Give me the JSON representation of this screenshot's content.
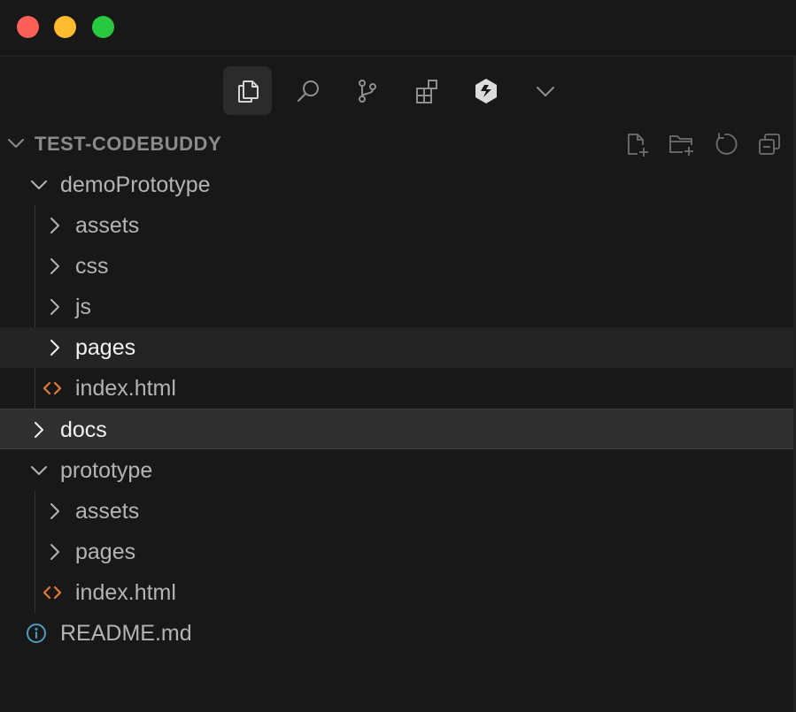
{
  "window": {
    "traffic_lights": [
      {
        "name": "close",
        "color": "#fe5f57"
      },
      {
        "name": "minimize",
        "color": "#febc2e"
      },
      {
        "name": "zoom",
        "color": "#28c840"
      }
    ]
  },
  "activity_bar": {
    "items": [
      {
        "icon": "files-icon",
        "active": true
      },
      {
        "icon": "search-icon",
        "active": false
      },
      {
        "icon": "source-control-icon",
        "active": false
      },
      {
        "icon": "extensions-icon",
        "active": false
      },
      {
        "icon": "codebuddy-icon",
        "active": false
      },
      {
        "icon": "chevron-down-icon",
        "active": false
      }
    ]
  },
  "explorer": {
    "section_title": "TEST-CODEBUDDY",
    "actions": [
      "new-file-icon",
      "new-folder-icon",
      "refresh-icon",
      "collapse-all-icon"
    ],
    "items": [
      {
        "label": "demoPrototype",
        "type": "folder",
        "expanded": true
      },
      {
        "label": "assets",
        "type": "folder",
        "expanded": false
      },
      {
        "label": "css",
        "type": "folder",
        "expanded": false
      },
      {
        "label": "js",
        "type": "folder",
        "expanded": false
      },
      {
        "label": "pages",
        "type": "folder",
        "expanded": false,
        "state": "hover"
      },
      {
        "label": "index.html",
        "type": "html-file"
      },
      {
        "label": "docs",
        "type": "folder",
        "expanded": false,
        "state": "selected"
      },
      {
        "label": "prototype",
        "type": "folder",
        "expanded": true
      },
      {
        "label": "assets",
        "type": "folder",
        "expanded": false
      },
      {
        "label": "pages",
        "type": "folder",
        "expanded": false
      },
      {
        "label": "index.html",
        "type": "html-file"
      },
      {
        "label": "README.md",
        "type": "info-file"
      }
    ]
  },
  "colors": {
    "background": "#181818",
    "selected_row": "#2f2f2f",
    "hover_row": "#242424",
    "html_icon": "#e37933",
    "info_icon": "#519aba",
    "text": "#b4b4b4",
    "text_bright": "#f2f2f2"
  }
}
